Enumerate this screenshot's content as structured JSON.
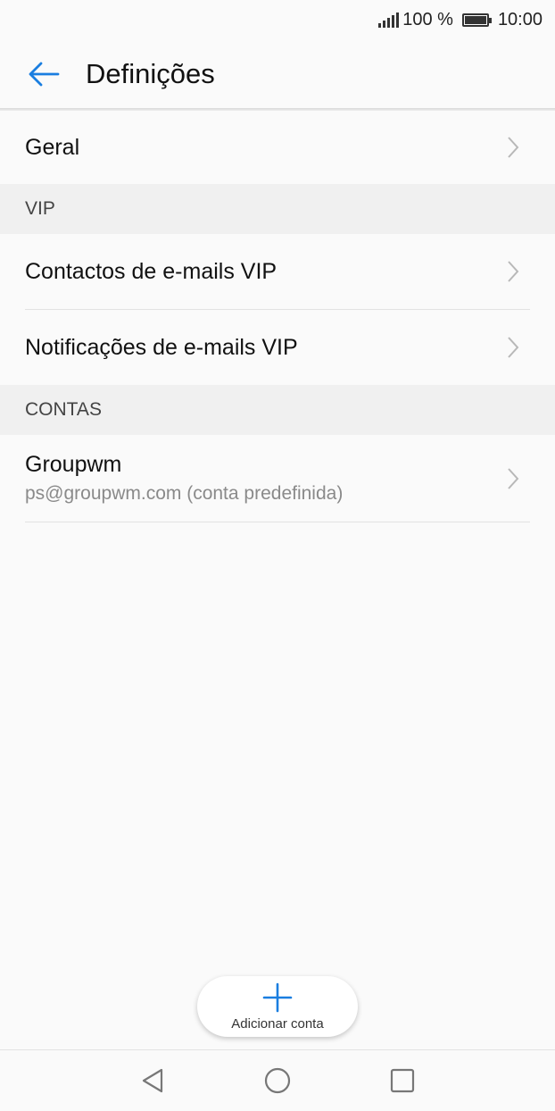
{
  "status_bar": {
    "battery_percent": "100 %",
    "time": "10:00",
    "signal_icon": "signal-icon",
    "battery_icon": "battery-icon"
  },
  "app_bar": {
    "title": "Definições",
    "back_icon": "arrow-left-icon",
    "accent_color": "#1a7ee0"
  },
  "rows": {
    "general": {
      "label": "Geral"
    }
  },
  "sections": {
    "vip": {
      "header": "VIP",
      "items": [
        {
          "label": "Contactos de e-mails VIP"
        },
        {
          "label": "Notificações de e-mails VIP"
        }
      ]
    },
    "accounts": {
      "header": "CONTAS",
      "items": [
        {
          "name": "Groupwm",
          "subtitle": "ps@groupwm.com (conta predefinida)"
        }
      ]
    }
  },
  "fab": {
    "label": "Adicionar conta",
    "icon": "plus-icon"
  },
  "nav_bar": {
    "back_icon": "triangle-back-icon",
    "home_icon": "circle-home-icon",
    "recents_icon": "square-recents-icon"
  }
}
